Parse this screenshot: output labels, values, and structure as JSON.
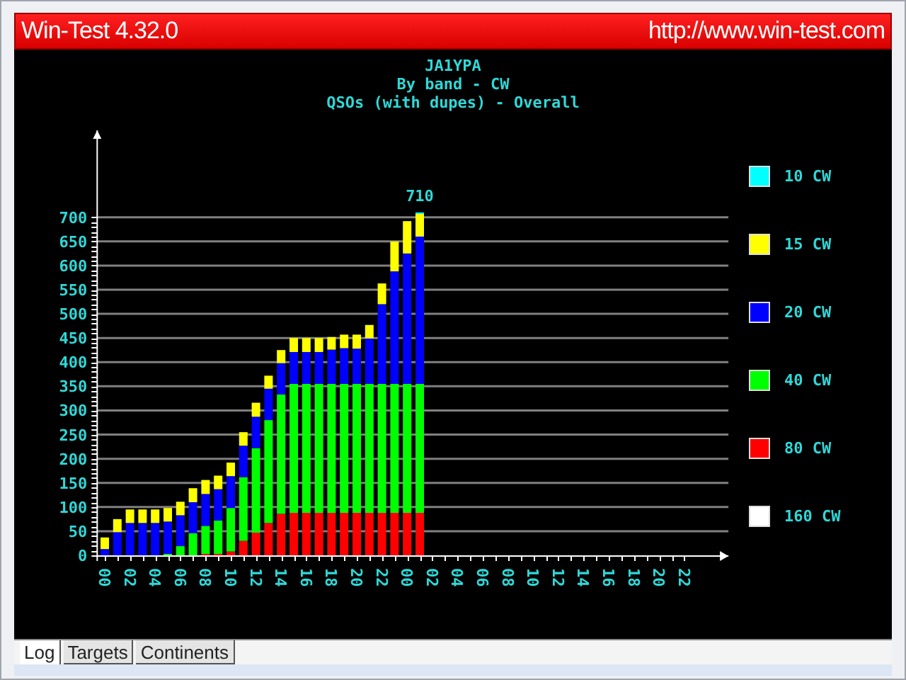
{
  "window": {
    "title": "Win-Test 4.32.0",
    "url": "http://www.win-test.com"
  },
  "header": [
    "JA1YPA",
    "By band - CW",
    "QSOs (with dupes) - Overall"
  ],
  "chart_data": {
    "type": "bar",
    "stacked": true,
    "x": [
      0,
      1,
      2,
      3,
      4,
      5,
      6,
      7,
      8,
      9,
      10,
      11,
      12,
      13,
      14,
      15,
      16,
      17,
      18,
      19,
      20,
      21,
      22,
      23,
      24,
      25
    ],
    "xlim": [
      -0.6,
      49.5
    ],
    "ylim": [
      0,
      880
    ],
    "grid": true,
    "yticks": [
      0,
      50,
      100,
      150,
      200,
      250,
      300,
      350,
      400,
      450,
      500,
      550,
      600,
      650,
      700
    ],
    "xticks": [
      {
        "value": 0,
        "label": "00"
      },
      {
        "value": 2,
        "label": "02"
      },
      {
        "value": 4,
        "label": "04"
      },
      {
        "value": 6,
        "label": "06"
      },
      {
        "value": 8,
        "label": "08"
      },
      {
        "value": 10,
        "label": "10"
      },
      {
        "value": 12,
        "label": "12"
      },
      {
        "value": 14,
        "label": "14"
      },
      {
        "value": 16,
        "label": "16"
      },
      {
        "value": 18,
        "label": "18"
      },
      {
        "value": 20,
        "label": "20"
      },
      {
        "value": 22,
        "label": "22"
      },
      {
        "value": 24,
        "label": "00"
      },
      {
        "value": 26,
        "label": "02"
      },
      {
        "value": 28,
        "label": "04"
      },
      {
        "value": 30,
        "label": "06"
      },
      {
        "value": 32,
        "label": "08"
      },
      {
        "value": 34,
        "label": "10"
      },
      {
        "value": 36,
        "label": "12"
      },
      {
        "value": 38,
        "label": "14"
      },
      {
        "value": 40,
        "label": "16"
      },
      {
        "value": 42,
        "label": "18"
      },
      {
        "value": 44,
        "label": "20"
      },
      {
        "value": 46,
        "label": "22"
      }
    ],
    "series": [
      {
        "name": "160 CW",
        "color": "#ffffff",
        "values": [
          0,
          0,
          0,
          0,
          0,
          0,
          0,
          0,
          0,
          0,
          0,
          0,
          0,
          0,
          0,
          0,
          0,
          0,
          0,
          0,
          0,
          0,
          0,
          0,
          0,
          0
        ]
      },
      {
        "name": "80 CW",
        "color": "#ff0000",
        "values": [
          0,
          0,
          0,
          0,
          0,
          0,
          0,
          0,
          3,
          3,
          8,
          30,
          47,
          67,
          86,
          88,
          88,
          88,
          88,
          88,
          88,
          88,
          88,
          88,
          88,
          88
        ]
      },
      {
        "name": "40 CW",
        "color": "#00ff00",
        "values": [
          0,
          0,
          0,
          0,
          0,
          3,
          19,
          46,
          58,
          69,
          90,
          132,
          175,
          213,
          247,
          267,
          267,
          267,
          267,
          267,
          267,
          267,
          267,
          267,
          267,
          267
        ]
      },
      {
        "name": "20 CW",
        "color": "#0000ff",
        "values": [
          13,
          48,
          67,
          67,
          67,
          67,
          64,
          64,
          66,
          65,
          66,
          65,
          65,
          65,
          65,
          66,
          66,
          66,
          71,
          74,
          73,
          94,
          165,
          233,
          270,
          305
        ]
      },
      {
        "name": "15 CW",
        "color": "#ffff00",
        "values": [
          24,
          27,
          28,
          28,
          28,
          28,
          28,
          29,
          29,
          28,
          28,
          28,
          29,
          27,
          27,
          29,
          29,
          29,
          26,
          28,
          29,
          28,
          43,
          62,
          67,
          48
        ]
      },
      {
        "name": "10 CW",
        "color": "#00ffff",
        "values": [
          0,
          0,
          0,
          0,
          0,
          0,
          0,
          0,
          0,
          0,
          0,
          0,
          0,
          0,
          0,
          0,
          0,
          0,
          0,
          0,
          0,
          0,
          0,
          0,
          0,
          2
        ]
      }
    ],
    "annotations": [
      {
        "x": 25,
        "y": 710,
        "text": "710"
      }
    ]
  },
  "tabs": [
    {
      "label": "Log",
      "selected": true
    },
    {
      "label": "Targets",
      "selected": false
    },
    {
      "label": "Continents",
      "selected": false
    }
  ]
}
